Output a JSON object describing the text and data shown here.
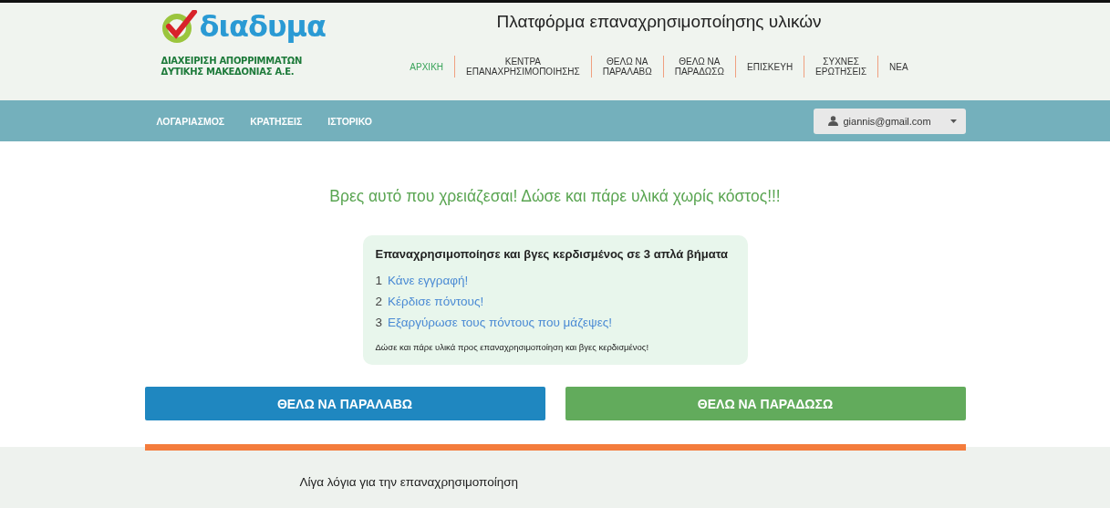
{
  "logo": {
    "wordmark": "διαδυμα",
    "subtitle": "ΔΙΑΧΕΙΡΙΣΗ ΑΠΟΡΡΙΜΜΑΤΩΝ\nΔΥΤΙΚΗΣ ΜΑΚΕΔΟΝΙΑΣ Α.Ε."
  },
  "title": "Πλατφόρμα επαναχρησιμοποίησης υλικών",
  "nav": [
    {
      "label": "ΑΡΧΙΚΗ",
      "selected": true
    },
    {
      "label": "ΚΕΝΤΡΑ\nΕΠΑΝΑΧΡΗΣΙΜΟΠΟΙΗΣΗΣ",
      "selected": false
    },
    {
      "label": "ΘΕΛΩ ΝΑ\nΠΑΡΑΛΑΒΩ",
      "selected": false
    },
    {
      "label": "ΘΕΛΩ ΝΑ\nΠΑΡΑΔΩΣΩ",
      "selected": false
    },
    {
      "label": "ΕΠΙΣΚΕΥΗ",
      "selected": false
    },
    {
      "label": "ΣΥΧΝΕΣ\nΕΡΩΤΗΣΕΙΣ",
      "selected": false
    },
    {
      "label": "ΝΕΑ",
      "selected": false
    }
  ],
  "account_bar": {
    "links": [
      "ΛΟΓΑΡΙΑΣΜΟΣ",
      "ΚΡΑΤΗΣΕΙΣ",
      "ΙΣΤΟΡΙΚΟ"
    ],
    "user": "giannis@gmail.com"
  },
  "headline": "Βρες αυτό που χρειάζεσαι! Δώσε και πάρε υλικά χωρίς κόστος!!!",
  "steps_card": {
    "title": "Επαναχρησιμοποίησε και βγες κερδισμένος σε 3 απλά βήματα",
    "steps": [
      {
        "number": "1",
        "text": "Κάνε εγγραφή!"
      },
      {
        "number": "2",
        "text": "Κέρδισε πόντους!"
      },
      {
        "number": "3",
        "text": "Εξαργύρωσε τους πόντους που μάζεψες!"
      }
    ],
    "note": "Δώσε και πάρε υλικά προς επαναχρησιμοποίηση και βγες κερδισμένος!"
  },
  "actions": [
    {
      "label": "ΘΕΛΩ ΝΑ ΠΑΡΑΛΑΒΩ",
      "color": "#1f87c0"
    },
    {
      "label": "ΘΕΛΩ ΝΑ ΠΑΡΑΔΩΣΩ",
      "color": "#62ab5c"
    }
  ],
  "about": {
    "title": "Λίγα λόγια για την επαναχρησιμοποίηση"
  }
}
